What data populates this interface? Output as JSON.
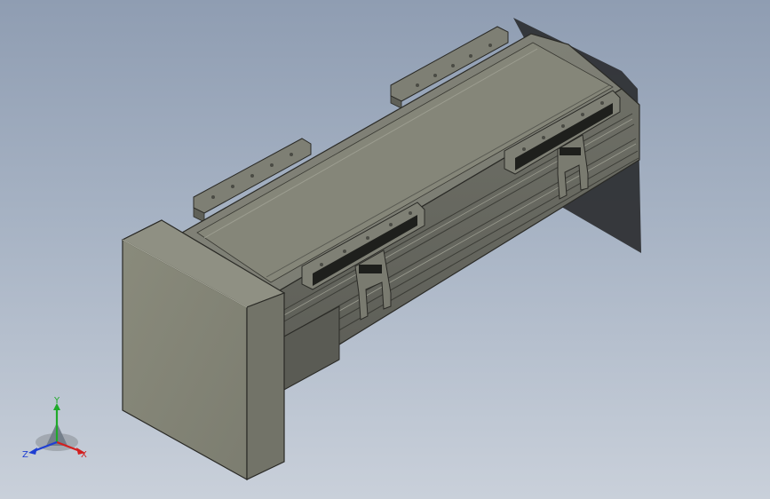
{
  "viewport": {
    "background_top": "#8f9db2",
    "background_bottom": "#c9d0da"
  },
  "model": {
    "body_color": "#8a8b7c",
    "top_color": "#7f8075",
    "side_color": "#6f7066",
    "edge_color": "#2a2a26",
    "shadow_color": "#2f3135"
  },
  "triad": {
    "x_label": "X",
    "y_label": "Y",
    "z_label": "Z",
    "x_color": "#d21f1f",
    "y_color": "#1faa2a",
    "z_color": "#1f3fd2"
  }
}
